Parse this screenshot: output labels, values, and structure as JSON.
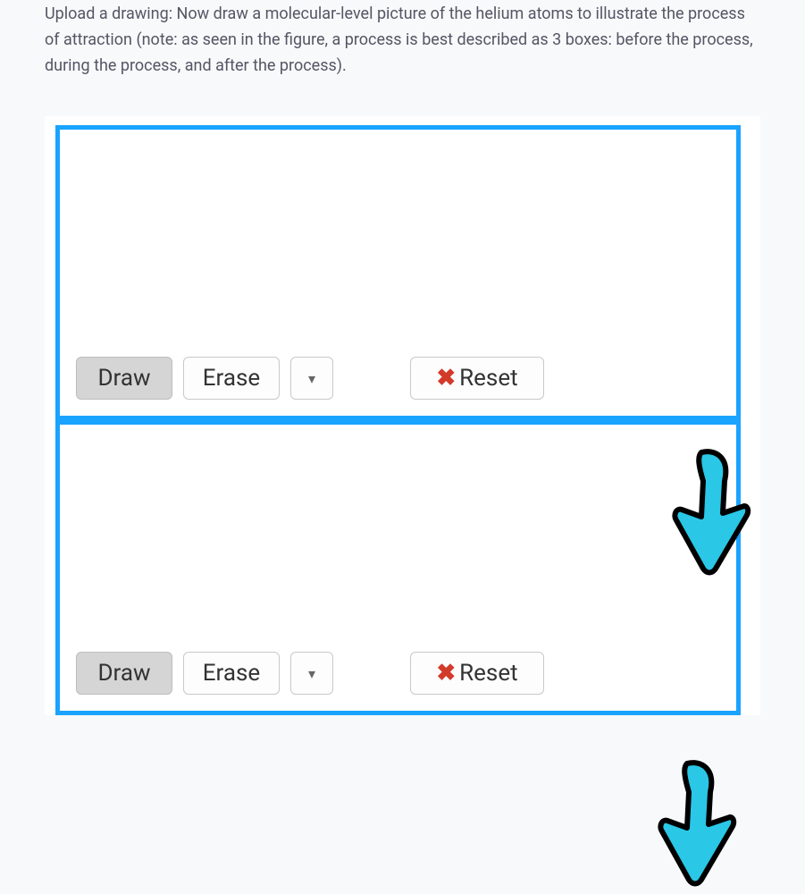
{
  "instruction": "Upload a drawing: Now draw a molecular-level picture of the helium atoms to illustrate the process of attraction (note: as seen in the figure, a process is best described as 3 boxes: before the process, during the process, and after the process).",
  "panels": [
    {
      "toolbar": {
        "draw_label": "Draw",
        "erase_label": "Erase",
        "reset_label": "Reset",
        "dropdown_glyph": "▾"
      }
    },
    {
      "toolbar": {
        "draw_label": "Draw",
        "erase_label": "Erase",
        "reset_label": "Reset",
        "dropdown_glyph": "▾"
      }
    }
  ],
  "colors": {
    "panel_border": "#1aa3ff",
    "reset_x": "#d23a2a",
    "arrow_fill": "#2ac7e6",
    "arrow_stroke": "#000000"
  }
}
